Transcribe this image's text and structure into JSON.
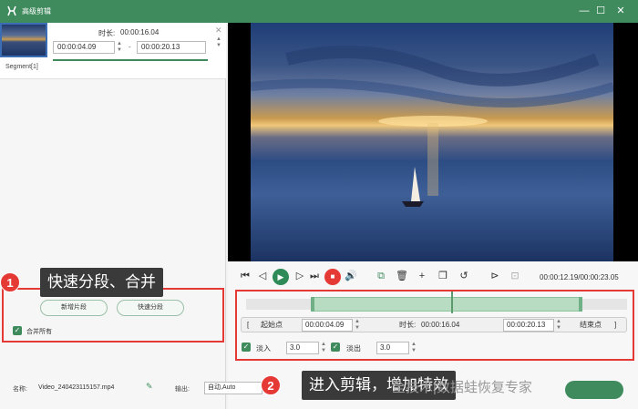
{
  "titlebar": {
    "title": "高级剪辑",
    "minimize_icon": "—",
    "maximize_icon": "☐",
    "close_icon": "✕"
  },
  "segment": {
    "label": "Segment[1]",
    "duration_label": "时长:",
    "duration_value": "00:00:16.04",
    "start_time": "00:00:04.09",
    "end_time": "00:00:20.13",
    "separator": "-"
  },
  "split_panel": {
    "new_segment_label": "新增片段",
    "quick_split_label": "快速分段",
    "merge_all_label": "合并所有",
    "merge_all_checked": true
  },
  "callouts": [
    {
      "number": "1",
      "text": "快速分段、合并"
    },
    {
      "number": "2",
      "text": "进入剪辑，增加特效"
    }
  ],
  "player": {
    "time_readout": "00:00:12.19/00:00:23.05"
  },
  "trim": {
    "start_bracket": "[",
    "start_label": "起始点",
    "start_value": "00:00:04.09",
    "duration_label": "时长:",
    "duration_value": "00:00:16.04",
    "end_value": "00:00:20.13",
    "end_label": "结束点",
    "end_bracket": "]",
    "fade_in_label": "淡入",
    "fade_in_value": "3.0",
    "fade_in_checked": true,
    "fade_out_label": "淡出",
    "fade_out_value": "3.0",
    "fade_out_checked": true
  },
  "bottom": {
    "name_label": "名称:",
    "file_name": "Video_240423115157.mp4",
    "output_label": "输出:",
    "output_value": "自动,Auto"
  },
  "watermark": "全技术|数据蛙恢复专家",
  "colors": {
    "accent": "#3f8b5e",
    "highlight": "#e53935",
    "callout_bg": "#3a3a3a"
  }
}
